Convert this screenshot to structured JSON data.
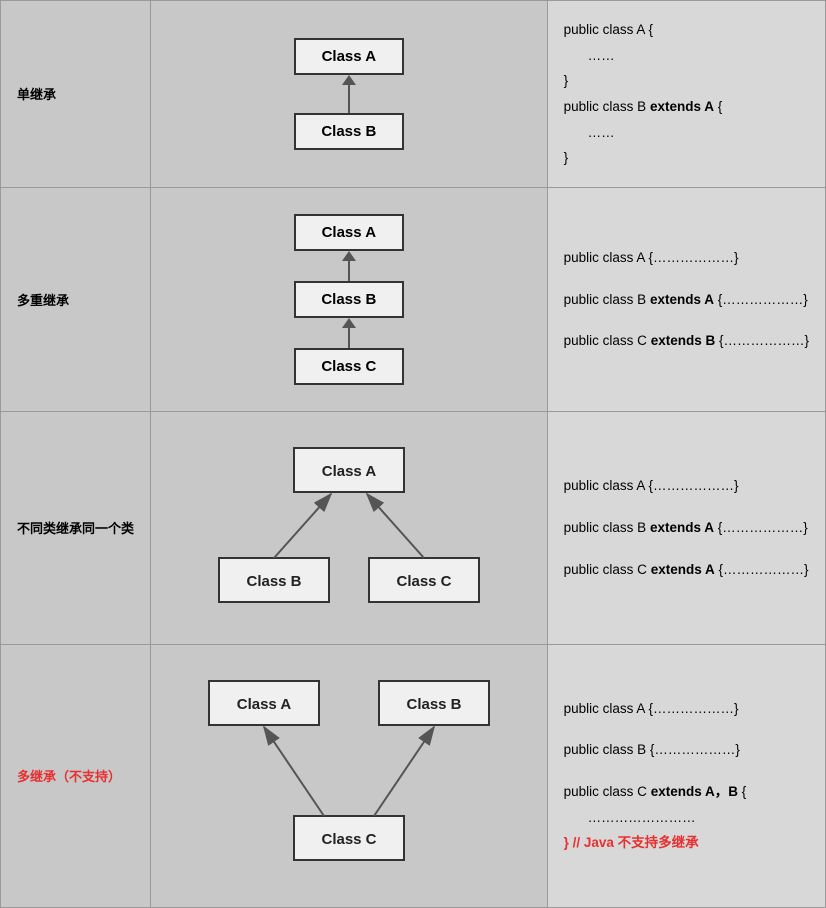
{
  "rows": [
    {
      "label": "单继承",
      "label_color": "black",
      "diagram_type": "single",
      "code_lines": [
        {
          "text": "public class A {",
          "bold": false,
          "red": false,
          "indent": false
        },
        {
          "text": "……",
          "bold": false,
          "red": false,
          "indent": true
        },
        {
          "text": "}",
          "bold": false,
          "red": false,
          "indent": false
        },
        {
          "text": "public class B ",
          "bold": false,
          "red": false,
          "inline_bold": "extends A",
          "suffix": " {",
          "indent": false
        },
        {
          "text": "……",
          "bold": false,
          "red": false,
          "indent": true
        },
        {
          "text": "}",
          "bold": false,
          "red": false,
          "indent": false
        }
      ]
    },
    {
      "label": "多重继承",
      "label_color": "black",
      "diagram_type": "multiple",
      "code_lines": [
        {
          "text": "public class A {………………}",
          "bold": false,
          "red": false,
          "indent": false
        },
        {
          "text": "",
          "blank": true
        },
        {
          "text": "public class B ",
          "bold": false,
          "red": false,
          "inline_bold": "extends A",
          "suffix": " {………………}",
          "indent": false
        },
        {
          "text": "",
          "blank": true
        },
        {
          "text": "public class C ",
          "bold": false,
          "red": false,
          "inline_bold": "extends B",
          "suffix": " {………………}",
          "indent": false
        }
      ]
    },
    {
      "label": "不同类继承同一个类",
      "label_color": "black",
      "diagram_type": "fan_out",
      "code_lines": [
        {
          "text": "public class A {………………}",
          "bold": false,
          "red": false,
          "indent": false
        },
        {
          "text": "",
          "blank": true
        },
        {
          "text": "public class B ",
          "bold": false,
          "red": false,
          "inline_bold": "extends A",
          "suffix": " {………………}",
          "indent": false
        },
        {
          "text": "",
          "blank": true
        },
        {
          "text": "public class C ",
          "bold": false,
          "red": false,
          "inline_bold": "extends A",
          "suffix": " {………………}",
          "indent": false
        }
      ]
    },
    {
      "label": "多继承（不支持）",
      "label_color": "red",
      "diagram_type": "multi_inherit",
      "code_lines": [
        {
          "text": "public class A {………………}",
          "bold": false,
          "red": false,
          "indent": false
        },
        {
          "text": "",
          "blank": true
        },
        {
          "text": "public class B {………………}",
          "bold": false,
          "red": false,
          "indent": false
        },
        {
          "text": "",
          "blank": true
        },
        {
          "text": "public class C ",
          "bold": false,
          "red": false,
          "inline_bold": "extends A，B",
          "suffix": " {",
          "indent": false
        },
        {
          "text": "……………………",
          "bold": false,
          "red": false,
          "indent": true
        },
        {
          "text": "} // Java 不支持多继承",
          "bold": false,
          "red": true,
          "indent": false
        }
      ]
    }
  ]
}
